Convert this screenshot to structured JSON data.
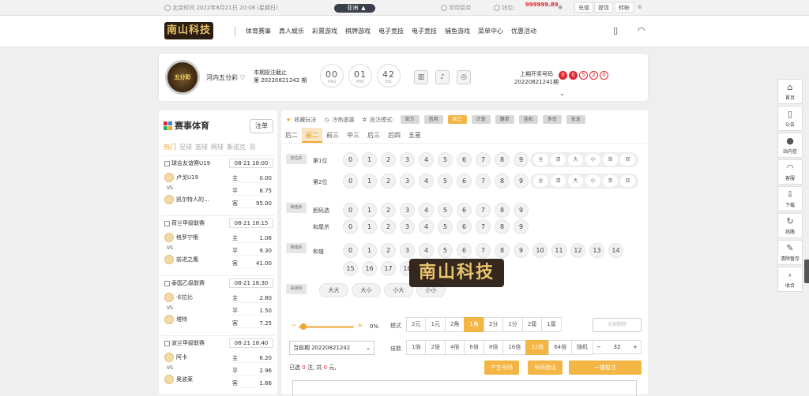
{
  "topbar": {
    "time": "北京时间 2022年8月21日 20:08 (星期日)",
    "pill": "亚洲",
    "common": "常用菜单",
    "balance_label": "钱包:",
    "balance": "999999.89",
    "actions": [
      "充值",
      "提现",
      "转帐"
    ]
  },
  "nav": {
    "logo": "南山科技",
    "items": [
      "体育赛事",
      "真人娱乐",
      "彩票游戏",
      "棋牌游戏",
      "电子竞技",
      "电子竞技",
      "捕鱼游戏",
      "菜单中心",
      "优惠活动"
    ]
  },
  "lottery": {
    "logo_text": "五分彩",
    "name": "河内五分彩",
    "issue_line1": "本期投注截止",
    "issue_line2": "第 20220821242 期",
    "countdown": [
      {
        "v": "00",
        "u": "HRS"
      },
      {
        "v": "01",
        "u": "MIN"
      },
      {
        "v": "42",
        "u": "SEC"
      }
    ],
    "prev_line1": "上期开奖号码",
    "prev_line2": "20220821241期",
    "prev_balls": [
      "0",
      "0",
      "5",
      "2",
      "0"
    ]
  },
  "sport": {
    "title": "赛事体育",
    "follow": "注单",
    "categories": [
      "热门",
      "足球",
      "篮球",
      "网球",
      "斯诺克",
      "羽"
    ],
    "matches": [
      {
        "league": "球会友谊赛U19",
        "time": "08-21 18:00",
        "home": "卢戈U19",
        "away": "凯尔特人的...",
        "odds": [
          [
            "主",
            "0.00"
          ],
          [
            "平",
            "8.75"
          ],
          [
            "客",
            "95.00"
          ]
        ]
      },
      {
        "league": "荷兰甲级联赛",
        "time": "08-21 18:15",
        "home": "格罗宁根",
        "away": "前进之鹰",
        "odds": [
          [
            "主",
            "1.06"
          ],
          [
            "平",
            "9.30"
          ],
          [
            "客",
            "41.00"
          ]
        ]
      },
      {
        "league": "泰国乙级联赛",
        "time": "08-21 18:30",
        "home": "卡拉比",
        "away": "塔特",
        "odds": [
          [
            "主",
            "2.80"
          ],
          [
            "平",
            "1.50"
          ],
          [
            "客",
            "7.25"
          ]
        ]
      },
      {
        "league": "波兰甲级联赛",
        "time": "08-21 18:40",
        "home": "阿卡",
        "away": "奥波莱",
        "odds": [
          [
            "主",
            "6.20"
          ],
          [
            "平",
            "2.96"
          ],
          [
            "客",
            "1.66"
          ]
        ]
      }
    ]
  },
  "play": {
    "links": [
      "收藏玩法",
      "冷热遗漏",
      "投注模式:"
    ],
    "modes": [
      "官方",
      "信用",
      "前三",
      "计划",
      "路单",
      "挂机",
      "多台",
      "长龙"
    ],
    "mode_active": 2,
    "tabs": [
      "后二",
      "前二",
      "前三",
      "中三",
      "后三",
      "后四",
      "五星"
    ],
    "tab_active": 1,
    "rows": {
      "r1_label": "定位杀",
      "r1_names": [
        "第1位",
        "第2位"
      ],
      "r2_label": "和值杀",
      "r2_names": [
        "胆码选",
        "和尾杀"
      ],
      "r3_label": "和值杀",
      "r3_name": "和值",
      "r4_label": "杀排列",
      "digits": [
        "0",
        "1",
        "2",
        "3",
        "4",
        "5",
        "6",
        "7",
        "8",
        "9"
      ],
      "sums_row1": [
        "0",
        "1",
        "2",
        "3",
        "4",
        "5",
        "6",
        "7",
        "8",
        "9",
        "10",
        "11",
        "12",
        "13",
        "14"
      ],
      "sums_row2": [
        "15",
        "16",
        "17",
        "18"
      ],
      "quick": [
        "全",
        "清",
        "大",
        "小",
        "单",
        "双"
      ],
      "big": [
        "大大",
        "大小",
        "小大",
        "小小"
      ]
    },
    "watermark": "南山科技"
  },
  "bet": {
    "percent": "0%",
    "unit_label": "模式",
    "units": [
      "2元",
      "1元",
      "2角",
      "1角",
      "2分",
      "1分",
      "2厘",
      "1厘"
    ],
    "unit_active": 3,
    "multi_label": "倍数",
    "multis": [
      "1倍",
      "2倍",
      "4倍",
      "6倍",
      "8倍",
      "16倍",
      "32倍",
      "64倍",
      "随机"
    ],
    "multi_active": 6,
    "issue": "当前期 20220821242",
    "multiplier_value": "32",
    "clear": "全部删除",
    "sel_prefix": "已选",
    "sel_count": "0",
    "sel_mid": "注, 共",
    "sel_amount": "0",
    "sel_suffix": "元,",
    "buttons": [
      "产生号码",
      "号码验证",
      "一键投注"
    ]
  },
  "rightbar": [
    {
      "icon": "home-icon",
      "label": "首页"
    },
    {
      "icon": "notice-icon",
      "label": "公告"
    },
    {
      "icon": "message-icon",
      "label": "站内信"
    },
    {
      "icon": "support-icon",
      "label": "客服"
    },
    {
      "icon": "download-icon",
      "label": "下载"
    },
    {
      "icon": "route-icon",
      "label": "线路"
    },
    {
      "icon": "broom-icon",
      "label": "清除暂存"
    },
    {
      "icon": "collapse-icon",
      "label": "收合"
    }
  ]
}
